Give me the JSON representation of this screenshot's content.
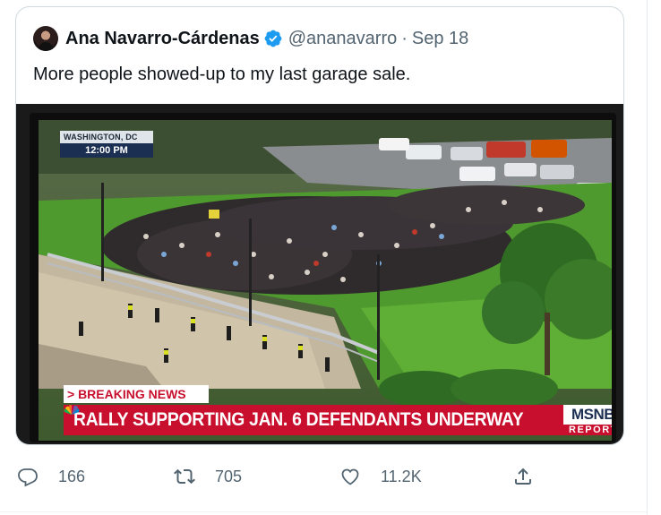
{
  "quoted_tweet": {
    "display_name": "Ana Navarro-Cárdenas",
    "handle": "@ananavarro",
    "separator": "·",
    "date": "Sep 18",
    "text": "More people showed-up to my last garage sale.",
    "verified": true,
    "media": {
      "locator_city": "WASHINGTON, DC",
      "locator_time": "12:00 PM",
      "breaking_label": "> BREAKING NEWS",
      "headline": "RALLY SUPPORTING JAN. 6 DEFENDANTS UNDERWAY",
      "network": "MSNBC",
      "network_sub": "REPORTS"
    }
  },
  "actions": {
    "reply": {
      "icon": "reply-icon",
      "count": "166"
    },
    "retweet": {
      "icon": "retweet-icon",
      "count": "705"
    },
    "like": {
      "icon": "heart-icon",
      "count": "11.2K"
    },
    "share": {
      "icon": "share-icon"
    }
  },
  "colors": {
    "verified_blue": "#1d9bf0",
    "muted_text": "#536471",
    "msnbc_red": "#c8102e",
    "msnbc_navy": "#1b2f52"
  }
}
